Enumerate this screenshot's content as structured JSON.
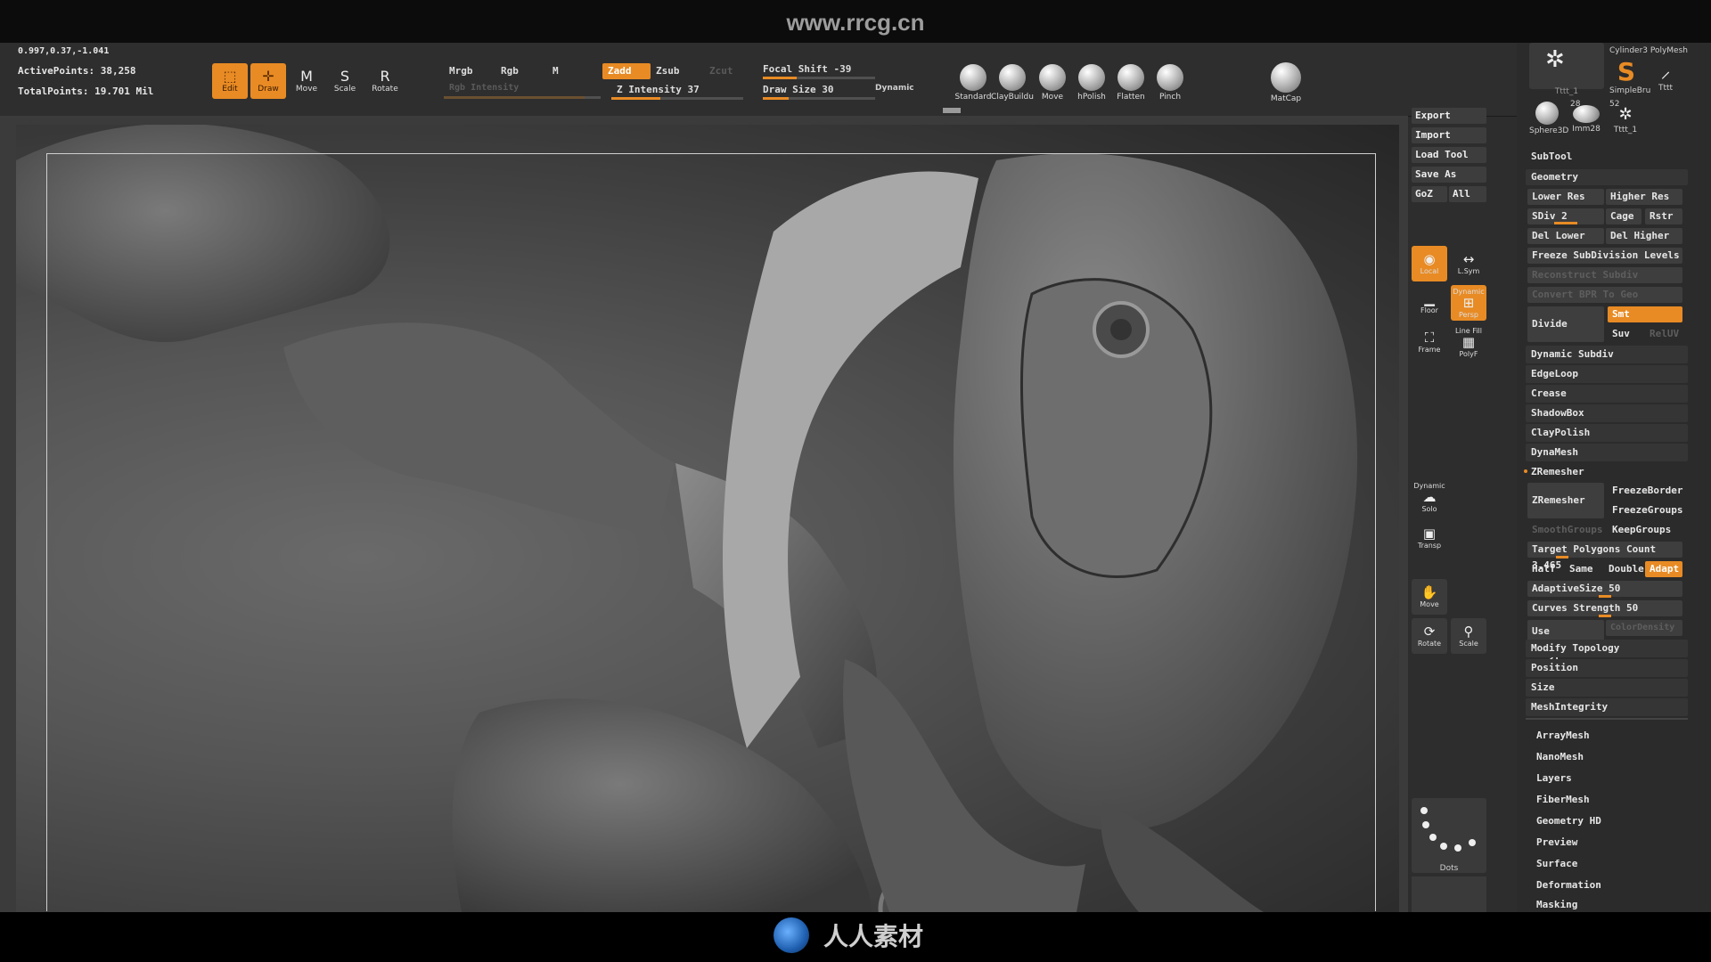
{
  "banner": {
    "title": "www.rrcg.cn"
  },
  "status": {
    "coords": "0.997,0.37,-1.041",
    "active_points": "ActivePoints: 38,258",
    "total_points": "TotalPoints: 19.701 Mil"
  },
  "tools": [
    {
      "label": "Edit",
      "icon": "edit-icon",
      "glyph": "⬚",
      "active": true
    },
    {
      "label": "Draw",
      "icon": "draw-icon",
      "glyph": "✛",
      "active": true
    },
    {
      "label": "Move",
      "icon": "move-icon",
      "glyph": "M",
      "active": false
    },
    {
      "label": "Scale",
      "icon": "scale-icon",
      "glyph": "S",
      "active": false
    },
    {
      "label": "Rotate",
      "icon": "rotate-icon",
      "glyph": "R",
      "active": false
    }
  ],
  "color_modes": {
    "mrgb": "Mrgb",
    "rgb": "Rgb",
    "m": "M",
    "rgb_intensity": "Rgb Intensity"
  },
  "sculpt_modes": {
    "zadd": "Zadd",
    "zsub": "Zsub",
    "zcut": "Zcut",
    "z_intensity": "Z Intensity 37"
  },
  "draw": {
    "focal_shift": "Focal Shift -39",
    "draw_size": "Draw Size 30",
    "dynamic": "Dynamic"
  },
  "sliders": {
    "rgb_intensity": 0.9,
    "z_intensity": 0.37,
    "focal_shift": 0.3,
    "draw_size": 0.23
  },
  "brushes": [
    {
      "label": "Standard",
      "icon": "standard-brush-icon"
    },
    {
      "label": "ClayBuildu",
      "icon": "claybuildup-brush-icon"
    },
    {
      "label": "Move",
      "icon": "move-brush-icon"
    },
    {
      "label": "hPolish",
      "icon": "hpolish-brush-icon"
    },
    {
      "label": "Flatten",
      "icon": "flatten-brush-icon"
    },
    {
      "label": "Pinch",
      "icon": "pinch-brush-icon"
    }
  ],
  "matcap": {
    "label": "MatCap"
  },
  "file_buttons": {
    "export": "Export",
    "import": "Import",
    "load_tool": "Load Tool",
    "save_as": "Save As",
    "goz": "GoZ",
    "all": "All"
  },
  "shelf": {
    "local": "Local",
    "lsym": "L.Sym",
    "floor": "Floor",
    "persp": "Persp",
    "dynamic": "Dynamic",
    "line_fill": "Line Fill",
    "frame": "Frame",
    "polyf": "PolyF",
    "solo_dynamic": "Dynamic",
    "solo": "Solo",
    "transp": "Transp",
    "move": "Move",
    "rotate": "Rotate",
    "scale": "Scale",
    "dots": "Dots"
  },
  "tool_palette": {
    "thumbs": [
      {
        "label": "Tttt_1",
        "icon": "tool-thumb-icon"
      },
      {
        "label": "Cylinder3 PolyMesh",
        "icon": "cylinder-thumb-icon"
      },
      {
        "label": "SimpleBru",
        "icon": "simplebrush-thumb-icon",
        "glyph": "S"
      },
      {
        "label": "Tttt",
        "icon": "tool-thumb-icon"
      },
      {
        "label": "Sphere3D",
        "icon": "sphere-thumb-icon"
      },
      {
        "label": "Imm28",
        "icon": "imm-thumb-icon",
        "badge": "28"
      },
      {
        "label": "Tttt_1",
        "icon": "tool-thumb-icon",
        "badge": "52"
      }
    ],
    "subtool": "SubTool",
    "geometry": "Geometry",
    "lower_res": "Lower Res",
    "higher_res": "Higher Res",
    "sdiv": "SDiv 2",
    "cage": "Cage",
    "rstr": "Rstr",
    "del_lower": "Del Lower",
    "del_higher": "Del Higher",
    "freeze_subdiv": "Freeze SubDivision Levels",
    "reconstruct_subdiv": "Reconstruct Subdiv",
    "convert_bpr": "Convert BPR To Geo",
    "divide": "Divide",
    "smt": "Smt",
    "suv": "Suv",
    "reluv": "RelUV",
    "dynamic_subdiv": "Dynamic Subdiv",
    "edgeloop": "EdgeLoop",
    "crease": "Crease",
    "shadowbox": "ShadowBox",
    "claypolish": "ClayPolish",
    "dynamesh": "DynaMesh",
    "zremesher_header": "ZRemesher",
    "zremesher_btn": "ZRemesher",
    "freezeborder": "FreezeBorder",
    "freezegroups": "FreezeGroups",
    "smoothgroups": "SmoothGroups",
    "keepgroups": "KeepGroups",
    "target_polygons": "Target Polygons Count 3.465",
    "half": "Half",
    "same": "Same",
    "double": "Double",
    "adapt": "Adapt",
    "adaptive_size": "AdaptiveSize 50",
    "curves_strength": "Curves Strength 50",
    "use_polypaint": "Use Polypaint",
    "color_density": "ColorDensity",
    "modify_topology": "Modify Topology",
    "position": "Position",
    "size": "Size",
    "meshintegrity": "MeshIntegrity",
    "sections": [
      "ArrayMesh",
      "NanoMesh",
      "Layers",
      "FiberMesh",
      "Geometry HD",
      "Preview",
      "Surface",
      "Deformation",
      "Masking"
    ]
  },
  "footer": {
    "logo_text": "人人素材"
  },
  "colors": {
    "accent": "#e88b24",
    "panel": "#353535",
    "background": "#2d2d2d"
  }
}
